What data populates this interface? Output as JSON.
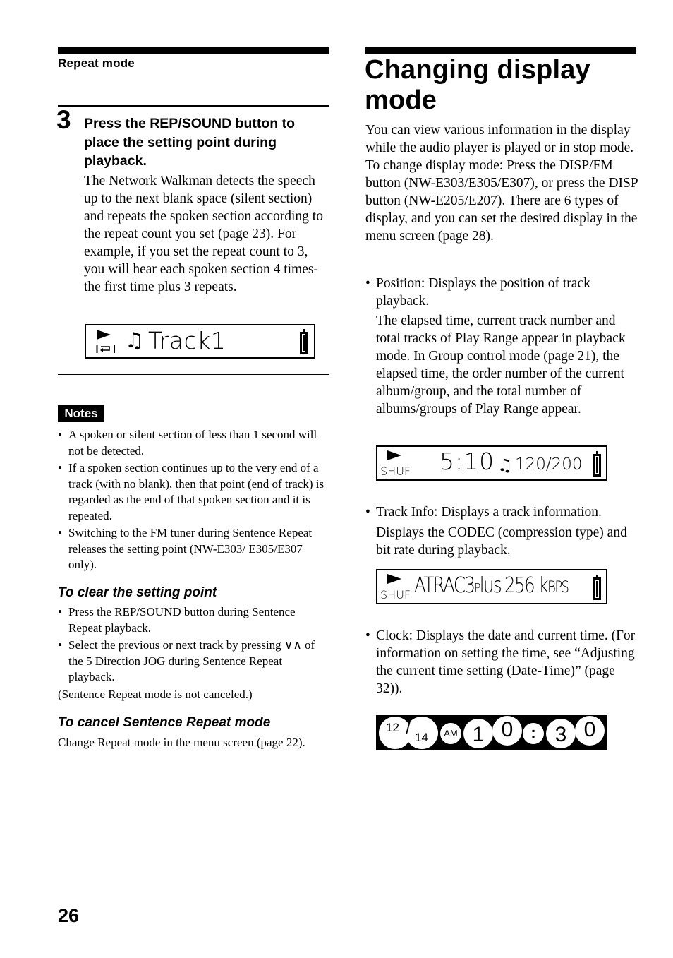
{
  "left": {
    "section_label": "Repeat mode",
    "step": {
      "number": "3",
      "title": "Press the REP/SOUND button to place the setting point during playback.",
      "body": "The Network Walkman detects the speech up to the next blank space (silent section) and repeats the spoken section according to the repeat count you set (page 23). For example, if you set the repeat count to 3, you will hear each spoken section 4 times- the first time plus 3 repeats."
    },
    "lcd_track": {
      "track_text": "Track1",
      "icons": [
        "play-icon",
        "sentence-repeat-icon",
        "music-note-icon",
        "battery-icon"
      ]
    },
    "notes": {
      "badge": "Notes",
      "items": [
        "A spoken or silent section of less than 1 second will not be detected.",
        "If a spoken section continues up to the very end of a track (with no blank), then that point (end of track) is regarded as the end of that spoken section and it is repeated.",
        "Switching to the FM tuner during Sentence Repeat releases the setting point (NW-E303/ E305/E307 only)."
      ]
    },
    "clear": {
      "heading": "To clear the setting point",
      "items": [
        "Press the REP/SOUND button during Sentence Repeat playback.",
        "Select the previous or next track by pressing ∨∧ of the 5 Direction JOG during Sentence Repeat playback."
      ],
      "note": "(Sentence Repeat mode is not canceled.)"
    },
    "cancel": {
      "heading": "To cancel Sentence Repeat mode",
      "body": "Change Repeat mode in the menu screen (page 22)."
    },
    "page_number": "26"
  },
  "right": {
    "title": "Changing display mode",
    "intro": "You can view various information in the display while the audio player is played or in stop mode. To change display mode: Press the DISP/FM button (NW-E303/E305/E307), or press the DISP button (NW-E205/E207). There are 6 types of display, and you can set the desired display in the menu screen (page 28).",
    "position": {
      "bullet": "Position: Displays the position of track playback.",
      "detail": "The elapsed time, current track number and total tracks of Play Range appear in playback mode. In Group control mode (page 21), the elapsed time, the order number of the current album/group, and the total number of albums/groups of Play Range appear.",
      "lcd": {
        "mode": "SHUF",
        "time": "5:10",
        "track_count": "120/200"
      }
    },
    "track_info": {
      "bullet": "Track Info: Displays a track information.",
      "detail": "Displays the CODEC (compression type) and bit rate during playback.",
      "lcd": {
        "mode": "SHUF",
        "codec": "ATRAC3plus",
        "codec_main": "ATRAC3",
        "codec_suffix_small": "P",
        "codec_suffix": "lus",
        "bitrate": "256",
        "unit_k": "k",
        "unit_bps": "bps"
      }
    },
    "clock": {
      "bullet": "Clock: Displays the date and current time. (For information on setting the time, see “Adjusting the current time setting (Date-Time)” (page 32)).",
      "lcd": {
        "month": "12",
        "slash": "/",
        "day": "14",
        "ampm": "AM",
        "h1": "1",
        "h2": "0",
        "colon": ":",
        "m1": "3",
        "m2": "0"
      }
    }
  }
}
